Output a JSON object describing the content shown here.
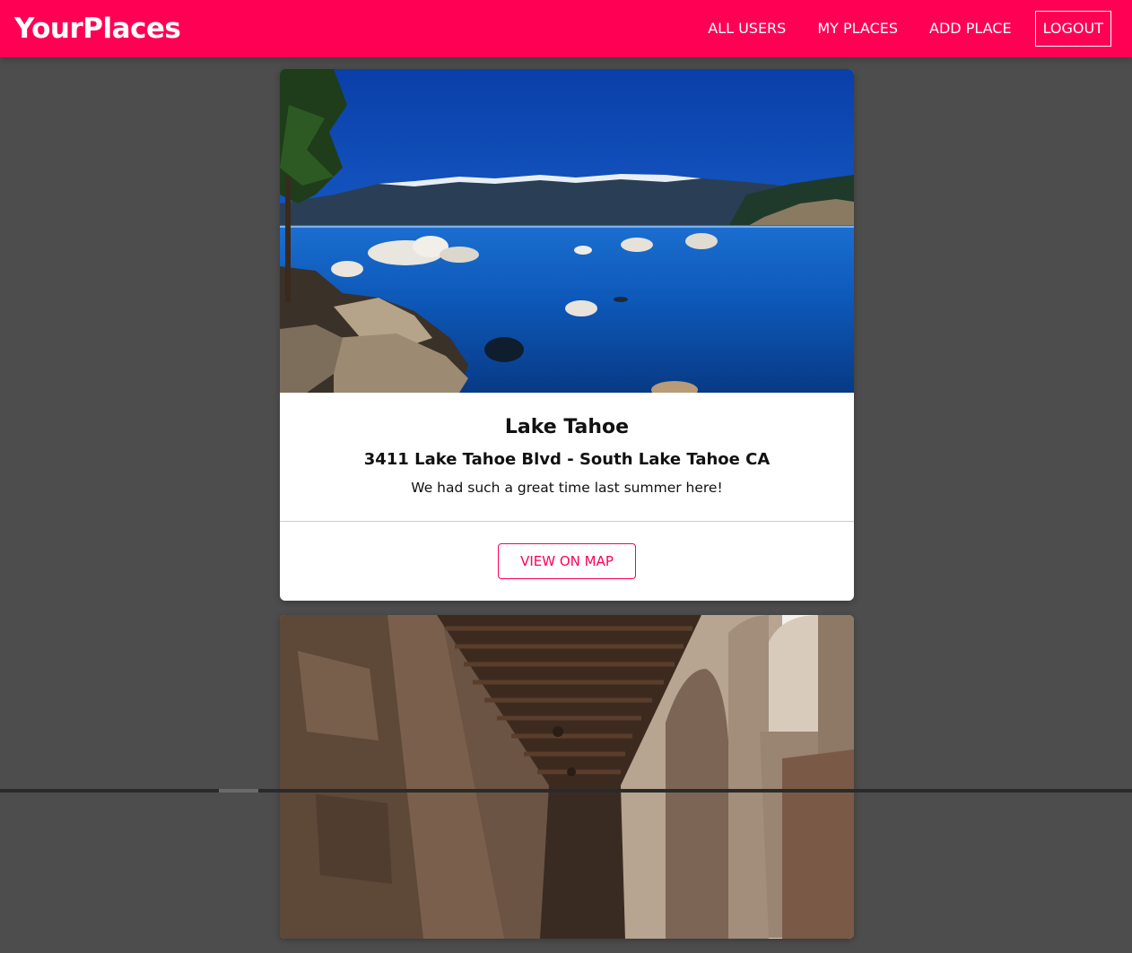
{
  "header": {
    "brand": "YourPlaces",
    "nav": {
      "all_users": "ALL USERS",
      "my_places": "MY PLACES",
      "add_place": "ADD PLACE",
      "logout": "LOGOUT"
    }
  },
  "places": [
    {
      "title": "Lake Tahoe",
      "address": "3411 Lake Tahoe Blvd - South Lake Tahoe CA",
      "description": "We had such a great time last summer here!",
      "view_on_map_label": "VIEW ON MAP",
      "image_subject": "lake-with-mountains-and-boulders"
    },
    {
      "image_subject": "stone-arched-corridor"
    }
  ],
  "colors": {
    "brand": "#ff0055",
    "background": "#4d4d4d",
    "card": "#ffffff"
  }
}
